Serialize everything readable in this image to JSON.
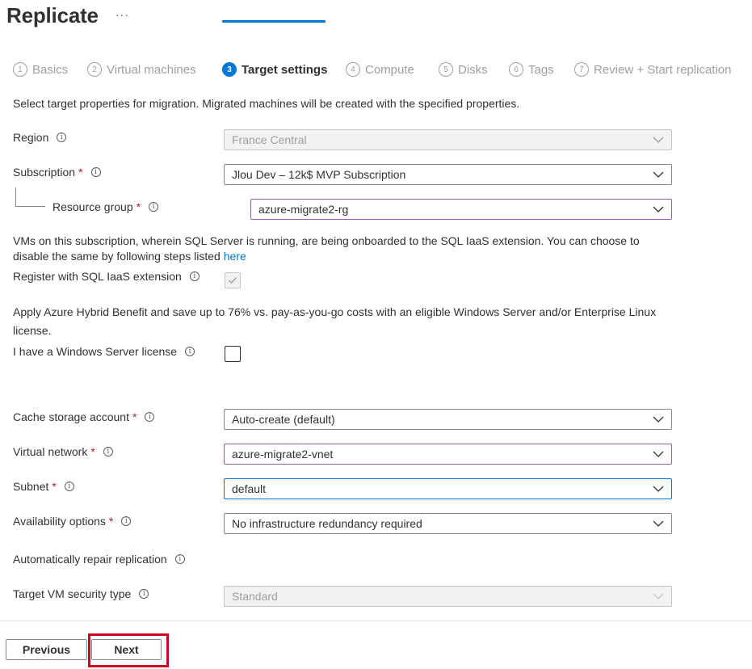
{
  "page": {
    "title": "Replicate",
    "more_label": "···"
  },
  "steps": [
    {
      "num": "1",
      "label": "Basics",
      "active": false
    },
    {
      "num": "2",
      "label": "Virtual machines",
      "active": false
    },
    {
      "num": "3",
      "label": "Target settings",
      "active": true
    },
    {
      "num": "4",
      "label": "Compute",
      "active": false
    },
    {
      "num": "5",
      "label": "Disks",
      "active": false
    },
    {
      "num": "6",
      "label": "Tags",
      "active": false
    },
    {
      "num": "7",
      "label": "Review + Start replication",
      "active": false
    }
  ],
  "intro_text": "Select target properties for migration. Migrated machines will be created with the specified properties.",
  "info_glyph": "i",
  "required_mark": "*",
  "region": {
    "label": "Region",
    "value": "France Central"
  },
  "subscription": {
    "label": "Subscription",
    "value": "Jlou Dev – 12k$ MVP Subscription"
  },
  "resource_group": {
    "label": "Resource group",
    "value": "azure-migrate2-rg"
  },
  "sql": {
    "notice_line1": "VMs on this subscription, wherein SQL Server is running, are being onboarded to the SQL IaaS extension. You can choose to",
    "notice_line2_prefix": "disable the same by following steps listed ",
    "notice_link": "here",
    "register_label": "Register with SQL IaaS extension",
    "register_checked": true
  },
  "hybrid": {
    "text_line1": "Apply Azure Hybrid Benefit and save up to 76% vs. pay-as-you-go costs with an eligible Windows Server and/or Enterprise Linux",
    "text_line2": "license.",
    "license_label": "I have a Windows Server license",
    "license_checked": false
  },
  "cache_storage": {
    "label": "Cache storage account",
    "value": "Auto-create (default)"
  },
  "virtual_network": {
    "label": "Virtual network",
    "value": "azure-migrate2-vnet"
  },
  "subnet": {
    "label": "Subnet",
    "value": "default"
  },
  "availability": {
    "label": "Availability options",
    "value": "No infrastructure redundancy required"
  },
  "auto_repair": {
    "label": "Automatically repair replication"
  },
  "security_type": {
    "label": "Target VM security type",
    "value": "Standard"
  },
  "footer": {
    "previous_label": "Previous",
    "next_label": "Next"
  },
  "colors": {
    "accent": "#0078d4",
    "required": "#a4262c",
    "highlight": "#d0021b",
    "focus_purple": "#8764b8"
  }
}
